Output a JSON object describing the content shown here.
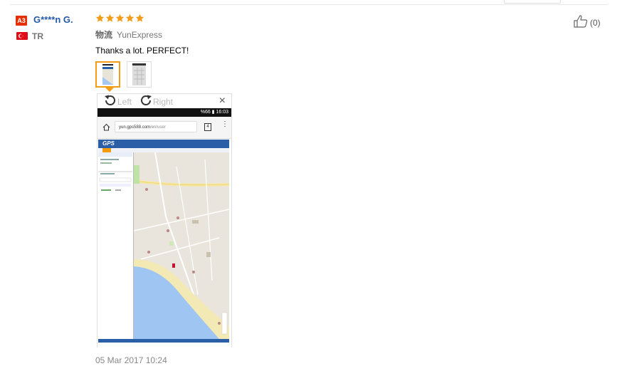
{
  "review": {
    "user": {
      "level": "A3",
      "name": "G****n G.",
      "country": "TR"
    },
    "rating": 5,
    "shipping": {
      "label": "物流",
      "carrier": "YunExpress"
    },
    "text": "Thanks a lot. PERFECT!",
    "helpful_count": "(0)",
    "date": "05 Mar 2017 10:24"
  },
  "viewer": {
    "rotate_left": "Left",
    "rotate_right": "Right",
    "close": "×"
  },
  "photo": {
    "status": "%66 ▮ 16:03",
    "url_host": "yun.gps588.com",
    "url_path": "/en/user",
    "tab_count": "4",
    "app_logo": "GPS"
  },
  "colors": {
    "star": "#f49b17",
    "username": "#2559a8",
    "level_badge": "#e62e04",
    "flag": "#e30a17",
    "selected_thumb_border": "#f49b17"
  },
  "icons": [
    "star-icon",
    "turkey-flag-icon",
    "thumbs-up-icon",
    "rotate-left-icon",
    "rotate-right-icon",
    "close-icon",
    "home-icon",
    "menu-dots-icon"
  ]
}
